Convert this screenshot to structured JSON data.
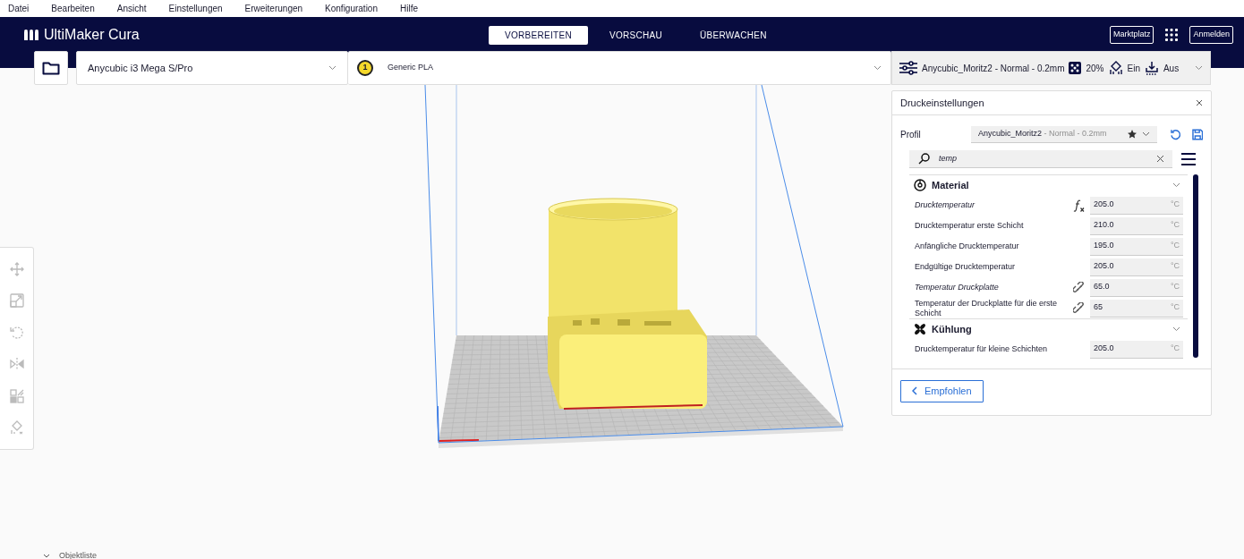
{
  "menu": [
    "Datei",
    "Bearbeiten",
    "Ansicht",
    "Einstellungen",
    "Erweiterungen",
    "Konfiguration",
    "Hilfe"
  ],
  "header": {
    "logo": "UltiMaker Cura",
    "stages": [
      {
        "label": "VORBEREITEN",
        "selected": true
      },
      {
        "label": "VORSCHAU",
        "selected": false
      },
      {
        "label": "ÜBERWACHEN",
        "selected": false
      }
    ],
    "marketplace": "Marktplatz",
    "signin": "Anmelden"
  },
  "toolbar": {
    "printer": "Anycubic i3 Mega S/Pro",
    "extruder": {
      "number": "1",
      "material": "Generic PLA"
    },
    "print_setup": {
      "profile": "Anycubic_Moritz2 - Normal - 0.2mm",
      "infill": "20%",
      "support": "Ein",
      "adhesion": "Aus"
    }
  },
  "panel": {
    "title": "Druckeinstellungen",
    "profile_label": "Profil",
    "profile_name": "Anycubic_Moritz2",
    "profile_suffix": " - Normal - 0.2mm",
    "search": "temp",
    "categories": [
      {
        "title": "Material",
        "expanded": true,
        "settings": [
          {
            "label": "Drucktemperatur",
            "modified": true,
            "formula": true,
            "linked": false,
            "value": "205.0",
            "unit": "°C"
          },
          {
            "label": "Drucktemperatur erste Schicht",
            "modified": false,
            "formula": false,
            "linked": false,
            "value": "210.0",
            "unit": "°C"
          },
          {
            "label": "Anfängliche Drucktemperatur",
            "modified": false,
            "formula": false,
            "linked": false,
            "value": "195.0",
            "unit": "°C"
          },
          {
            "label": "Endgültige Drucktemperatur",
            "modified": false,
            "formula": false,
            "linked": false,
            "value": "205.0",
            "unit": "°C"
          },
          {
            "label": "Temperatur Druckplatte",
            "modified": true,
            "formula": false,
            "linked": true,
            "value": "65.0",
            "unit": "°C"
          },
          {
            "label": "Temperatur der Druckplatte für die erste Schicht",
            "modified": false,
            "formula": false,
            "linked": true,
            "value": "65",
            "unit": "°C"
          }
        ]
      },
      {
        "title": "Kühlung",
        "expanded": true,
        "settings": [
          {
            "label": "Drucktemperatur für kleine Schichten",
            "modified": false,
            "formula": false,
            "linked": false,
            "value": "205.0",
            "unit": "°C"
          }
        ]
      }
    ],
    "footer_button": "Empfohlen"
  },
  "object_list": "Objektliste"
}
